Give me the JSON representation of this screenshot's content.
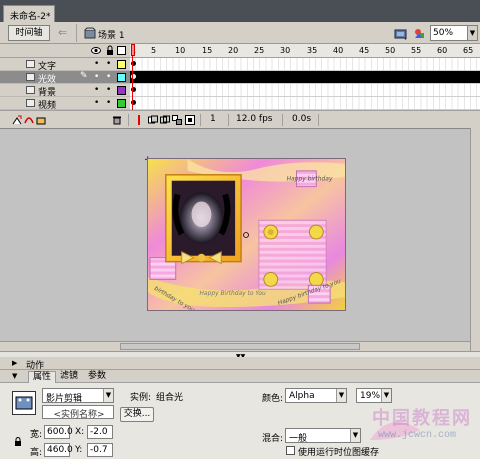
{
  "document": {
    "tab_label": "未命名-2*"
  },
  "toolbar": {
    "timeline_button": "时间轴",
    "back_arrow": "⇐",
    "scene_label": "场景 1",
    "zoom_value": "50%"
  },
  "timeline": {
    "ruler_numbers": [
      "1",
      "5",
      "10",
      "15",
      "20",
      "25",
      "30",
      "35",
      "40",
      "45",
      "50",
      "55",
      "60",
      "65"
    ],
    "layers": [
      {
        "name": "文字",
        "color": "#ffff66",
        "selected": false
      },
      {
        "name": "光效",
        "color": "#66ffff",
        "selected": true
      },
      {
        "name": "背景",
        "color": "#9933cc",
        "selected": false
      },
      {
        "name": "视频",
        "color": "#33cc33",
        "selected": false
      }
    ],
    "footer": {
      "current_frame": "1",
      "frame_rate": "12.0 fps",
      "elapsed_time": "0.0s"
    }
  },
  "artwork": {
    "text_happy_birthday_top": "Happy birthday",
    "text_birthday_to_you_left": "birthday to you",
    "text_happy_birthday_bottom": "Happy Birthday to You",
    "text_happy_birthday_right": "Happy birthday to you"
  },
  "panels": {
    "actions_title": "动作",
    "tabs": [
      "属性",
      "滤镜",
      "参数"
    ]
  },
  "properties": {
    "symbol_type": "影片剪辑",
    "instance_name_placeholder": "<实例名称>",
    "instance_label": "实例:",
    "instance_name": "组合光",
    "swap_button": "交换...",
    "color_label": "颜色:",
    "color_mode": "Alpha",
    "alpha_value": "19%",
    "width_label": "宽:",
    "width_value": "600.0",
    "height_label": "高:",
    "height_value": "460.0",
    "x_label": "X:",
    "x_value": "-2.0",
    "y_label": "Y:",
    "y_value": "-0.7",
    "blend_label": "混合:",
    "blend_value": "一般",
    "cache_checkbox_label": "使用运行时位图缓存"
  },
  "watermark": {
    "site_name": "中国教程网",
    "site_url": "www.jcwcn.com"
  }
}
